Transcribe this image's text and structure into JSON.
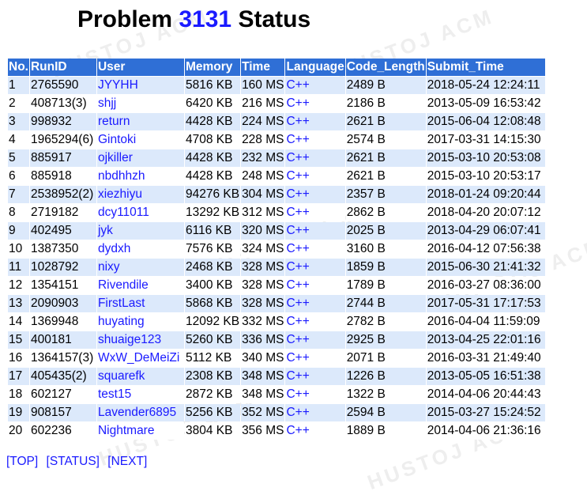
{
  "header": {
    "prefix": "Problem",
    "problem_id": "3131",
    "suffix": "Status"
  },
  "watermark": "HUSTOJ ACM",
  "table": {
    "columns": [
      "No.",
      "RunID",
      "User",
      "Memory",
      "Time",
      "Language",
      "Code_Length",
      "Submit_Time"
    ],
    "rows": [
      [
        "1",
        "2765590",
        "JYYHH",
        "5816 KB",
        "160 MS",
        "C++",
        "2489 B",
        "2018-05-24 12:24:11"
      ],
      [
        "2",
        "408713(3)",
        "shjj",
        "6420 KB",
        "216 MS",
        "C++",
        "2186 B",
        "2013-05-09 16:53:42"
      ],
      [
        "3",
        "998932",
        "return",
        "4428 KB",
        "224 MS",
        "C++",
        "2621 B",
        "2015-06-04 12:08:48"
      ],
      [
        "4",
        "1965294(6)",
        "Gintoki",
        "4708 KB",
        "228 MS",
        "C++",
        "2574 B",
        "2017-03-31 14:15:30"
      ],
      [
        "5",
        "885917",
        "ojkiller",
        "4428 KB",
        "232 MS",
        "C++",
        "2621 B",
        "2015-03-10 20:53:08"
      ],
      [
        "6",
        "885918",
        "nbdhhzh",
        "4428 KB",
        "248 MS",
        "C++",
        "2621 B",
        "2015-03-10 20:53:17"
      ],
      [
        "7",
        "2538952(2)",
        "xiezhiyu",
        "94276 KB",
        "304 MS",
        "C++",
        "2357 B",
        "2018-01-24 09:20:44"
      ],
      [
        "8",
        "2719182",
        "dcy11011",
        "13292 KB",
        "312 MS",
        "C++",
        "2862 B",
        "2018-04-20 20:07:12"
      ],
      [
        "9",
        "402495",
        "jyk",
        "6116 KB",
        "320 MS",
        "C++",
        "2025 B",
        "2013-04-29 06:07:41"
      ],
      [
        "10",
        "1387350",
        "dydxh",
        "7576 KB",
        "324 MS",
        "C++",
        "3160 B",
        "2016-04-12 07:56:38"
      ],
      [
        "11",
        "1028792",
        "nixy",
        "2468 KB",
        "328 MS",
        "C++",
        "1859 B",
        "2015-06-30 21:41:32"
      ],
      [
        "12",
        "1354151",
        "Rivendile",
        "3400 KB",
        "328 MS",
        "C++",
        "1789 B",
        "2016-03-27 08:36:00"
      ],
      [
        "13",
        "2090903",
        "FirstLast",
        "5868 KB",
        "328 MS",
        "C++",
        "2744 B",
        "2017-05-31 17:17:53"
      ],
      [
        "14",
        "1369948",
        "huyating",
        "12092 KB",
        "332 MS",
        "C++",
        "2782 B",
        "2016-04-04 11:59:09"
      ],
      [
        "15",
        "400181",
        "shuaige123",
        "5260 KB",
        "336 MS",
        "C++",
        "2925 B",
        "2013-04-25 22:01:16"
      ],
      [
        "16",
        "1364157(3)",
        "WxW_DeMeiZi",
        "5112 KB",
        "340 MS",
        "C++",
        "2071 B",
        "2016-03-31 21:49:40"
      ],
      [
        "17",
        "405435(2)",
        "squarefk",
        "2308 KB",
        "348 MS",
        "C++",
        "1226 B",
        "2013-05-05 16:51:38"
      ],
      [
        "18",
        "602127",
        "test15",
        "2872 KB",
        "348 MS",
        "C++",
        "1322 B",
        "2014-04-06 20:44:43"
      ],
      [
        "19",
        "908157",
        "Lavender6895",
        "5256 KB",
        "352 MS",
        "C++",
        "2594 B",
        "2015-03-27 15:24:52"
      ],
      [
        "20",
        "602236",
        "Nightmare",
        "3804 KB",
        "356 MS",
        "C++",
        "1889 B",
        "2014-04-06 21:36:16"
      ]
    ]
  },
  "nav": [
    "[TOP]",
    "[STATUS]",
    "[NEXT]"
  ],
  "colors": {
    "header_bg": "#2f6fd6",
    "odd_row_bg": "#dce9fb",
    "link": "#1a1aff"
  }
}
